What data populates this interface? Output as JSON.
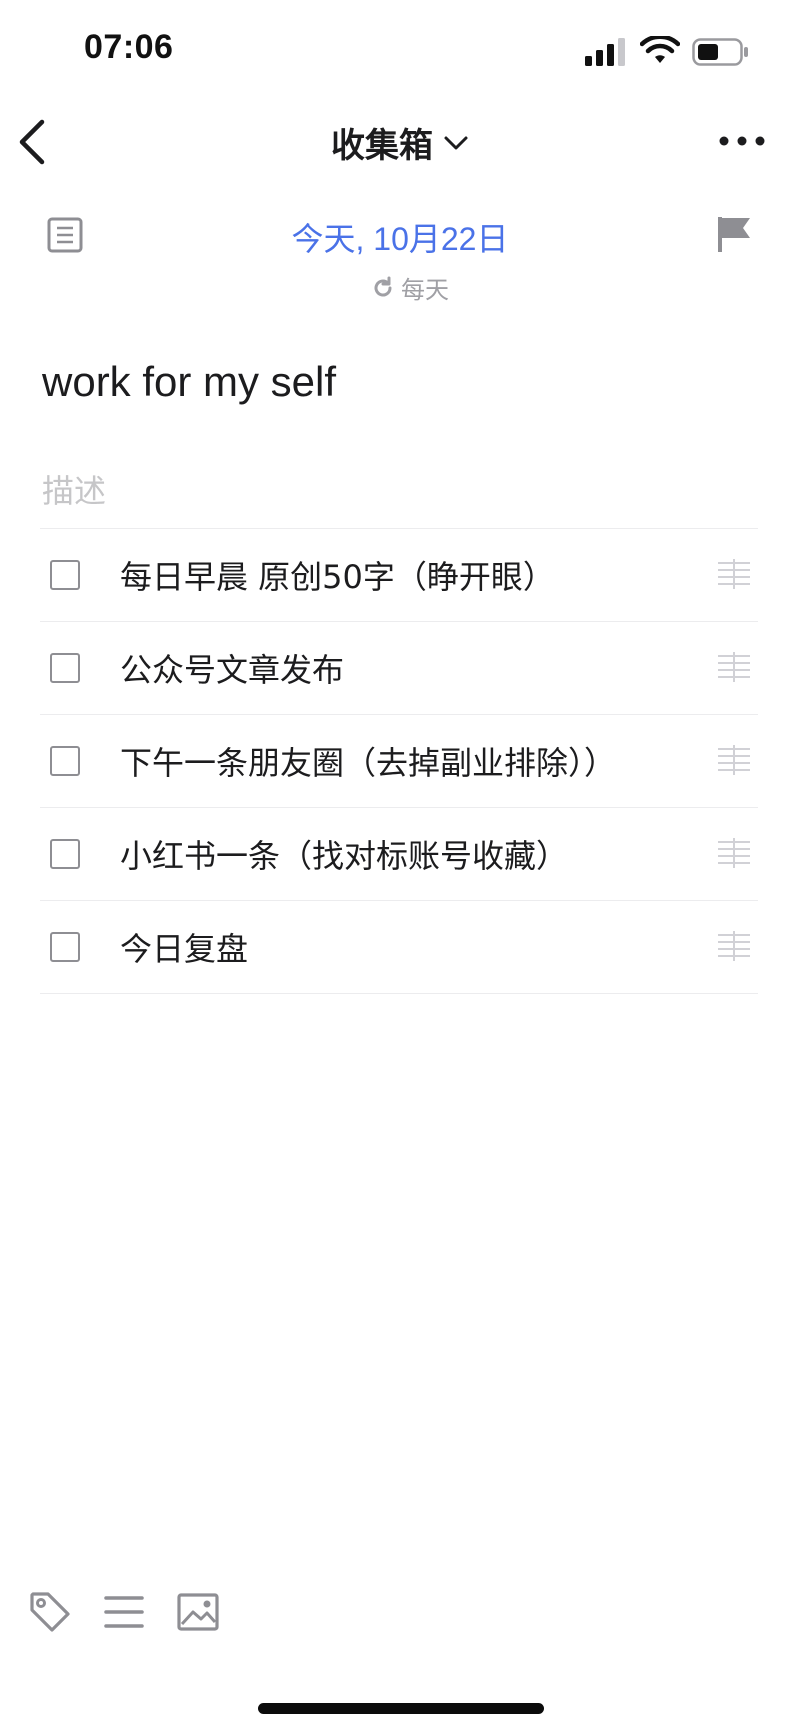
{
  "status_bar": {
    "time": "07:06"
  },
  "nav": {
    "title": "收集箱"
  },
  "task": {
    "date": "今天, 10月22日",
    "repeat": "每天",
    "title": "work for my self",
    "description_placeholder": "描述",
    "checklist": [
      {
        "text": "每日早晨 原创50字（睁开眼）",
        "checked": false
      },
      {
        "text": "公众号文章发布",
        "checked": false
      },
      {
        "text": "下午一条朋友圈（去掉副业排除））",
        "checked": false
      },
      {
        "text": "小红书一条（找对标账号收藏）",
        "checked": false
      },
      {
        "text": "今日复盘",
        "checked": false
      }
    ]
  },
  "colors": {
    "accent": "#4a72e8",
    "text": "#1c1c1e",
    "muted": "#a0a0a5",
    "divider": "#ececee"
  },
  "icons": [
    "back-chevron-icon",
    "dropdown-chevron-icon",
    "more-icon",
    "note-icon",
    "repeat-icon",
    "flag-icon",
    "checkbox-icon",
    "drag-handle-icon",
    "tag-icon",
    "list-icon",
    "image-icon"
  ]
}
